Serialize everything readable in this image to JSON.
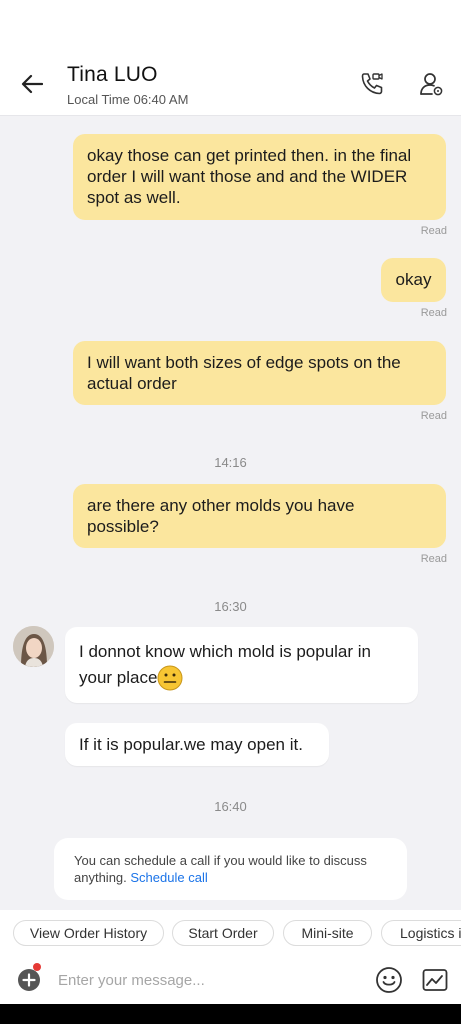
{
  "header": {
    "title": "Tina LUO",
    "subtitle": "Local Time 06:40 AM"
  },
  "messages": {
    "m1": {
      "lines": [
        "okay those can get printed then. in the final",
        "order I will want those and and the WIDER",
        "spot as well."
      ],
      "status": "Read"
    },
    "m2": {
      "text": "okay",
      "status": "Read"
    },
    "m3": {
      "lines": [
        "I will want both sizes of edge spots on the",
        "actual order"
      ],
      "status": "Read"
    },
    "sep1": "14:16",
    "m4": {
      "lines": [
        "are there any other molds you have",
        "possible?"
      ],
      "status": "Read"
    },
    "sep2": "16:30",
    "m5": {
      "line1": "I donnot know which mold is popular in",
      "line2": "your place"
    },
    "m6": {
      "text": "If it is popular.we may open it."
    },
    "sep3": "16:40"
  },
  "notice": {
    "text": "You can schedule a call if you would like to discuss anything.",
    "link": "Schedule call"
  },
  "quick_actions": [
    "View Order History",
    "Start Order",
    "Mini-site",
    "Logistics i"
  ],
  "composer": {
    "placeholder": "Enter your message..."
  },
  "icons": {
    "back": "arrow-left-icon",
    "call": "video-call-icon",
    "profile": "user-settings-icon",
    "add": "plus-circle-icon",
    "emoji": "smiley-icon",
    "image": "image-icon"
  },
  "colors": {
    "outgoing_bubble": "#fbe69e",
    "incoming_bubble": "#ffffff",
    "background": "#f2f2f5",
    "link": "#1a73e8",
    "notification_dot": "#e53935"
  }
}
